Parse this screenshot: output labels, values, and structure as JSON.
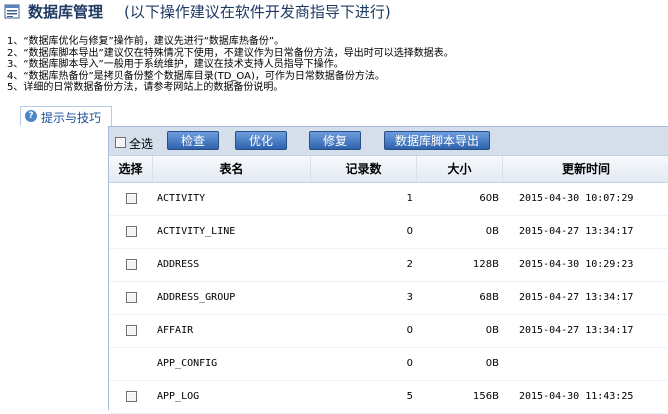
{
  "header": {
    "title": "数据库管理",
    "subtitle": "(以下操作建议在软件开发商指导下进行)",
    "icon": "database-icon"
  },
  "instructions": [
    "1、“数据库优化与修复”操作前，建议先进行“数据库热备份”。",
    "2、“数据库脚本导出”建议仅在特殊情况下使用，不建议作为日常备份方法，导出时可以选择数据表。",
    "3、“数据库脚本导入”一般用于系统维护，建议在技术支持人员指导下操作。",
    "4、“数据库热备份”是拷贝备份整个数据库目录(TD_OA)，可作为日常数据备份方法。",
    "5、详细的日常数据备份方法，请参考网站上的数据备份说明。"
  ],
  "tip_tab": {
    "label": "提示与技巧",
    "icon": "help-icon"
  },
  "toolbar": {
    "select_all": "全选",
    "check": "检查",
    "optimize": "优化",
    "repair": "修复",
    "export": "数据库脚本导出"
  },
  "table": {
    "headers": {
      "select": "选择",
      "name": "表名",
      "count": "记录数",
      "size": "大小",
      "updated": "更新时间"
    },
    "rows": [
      {
        "name": "ACTIVITY",
        "count": "1",
        "size": "60B",
        "updated": "2015-04-30 10:07:29",
        "checkbox": true
      },
      {
        "name": "ACTIVITY_LINE",
        "count": "0",
        "size": "0B",
        "updated": "2015-04-27 13:34:17",
        "checkbox": true
      },
      {
        "name": "ADDRESS",
        "count": "2",
        "size": "128B",
        "updated": "2015-04-30 10:29:23",
        "checkbox": true
      },
      {
        "name": "ADDRESS_GROUP",
        "count": "3",
        "size": "68B",
        "updated": "2015-04-27 13:34:17",
        "checkbox": true
      },
      {
        "name": "AFFAIR",
        "count": "0",
        "size": "0B",
        "updated": "2015-04-27 13:34:17",
        "checkbox": true
      },
      {
        "name": "APP_CONFIG",
        "count": "0",
        "size": "0B",
        "updated": "",
        "checkbox": false
      },
      {
        "name": "APP_LOG",
        "count": "5",
        "size": "156B",
        "updated": "2015-04-30 11:43:25",
        "checkbox": true
      }
    ]
  },
  "colors": {
    "title": "#1f3b64",
    "button": "#2f62ad",
    "panel": "#d4dfeb"
  }
}
